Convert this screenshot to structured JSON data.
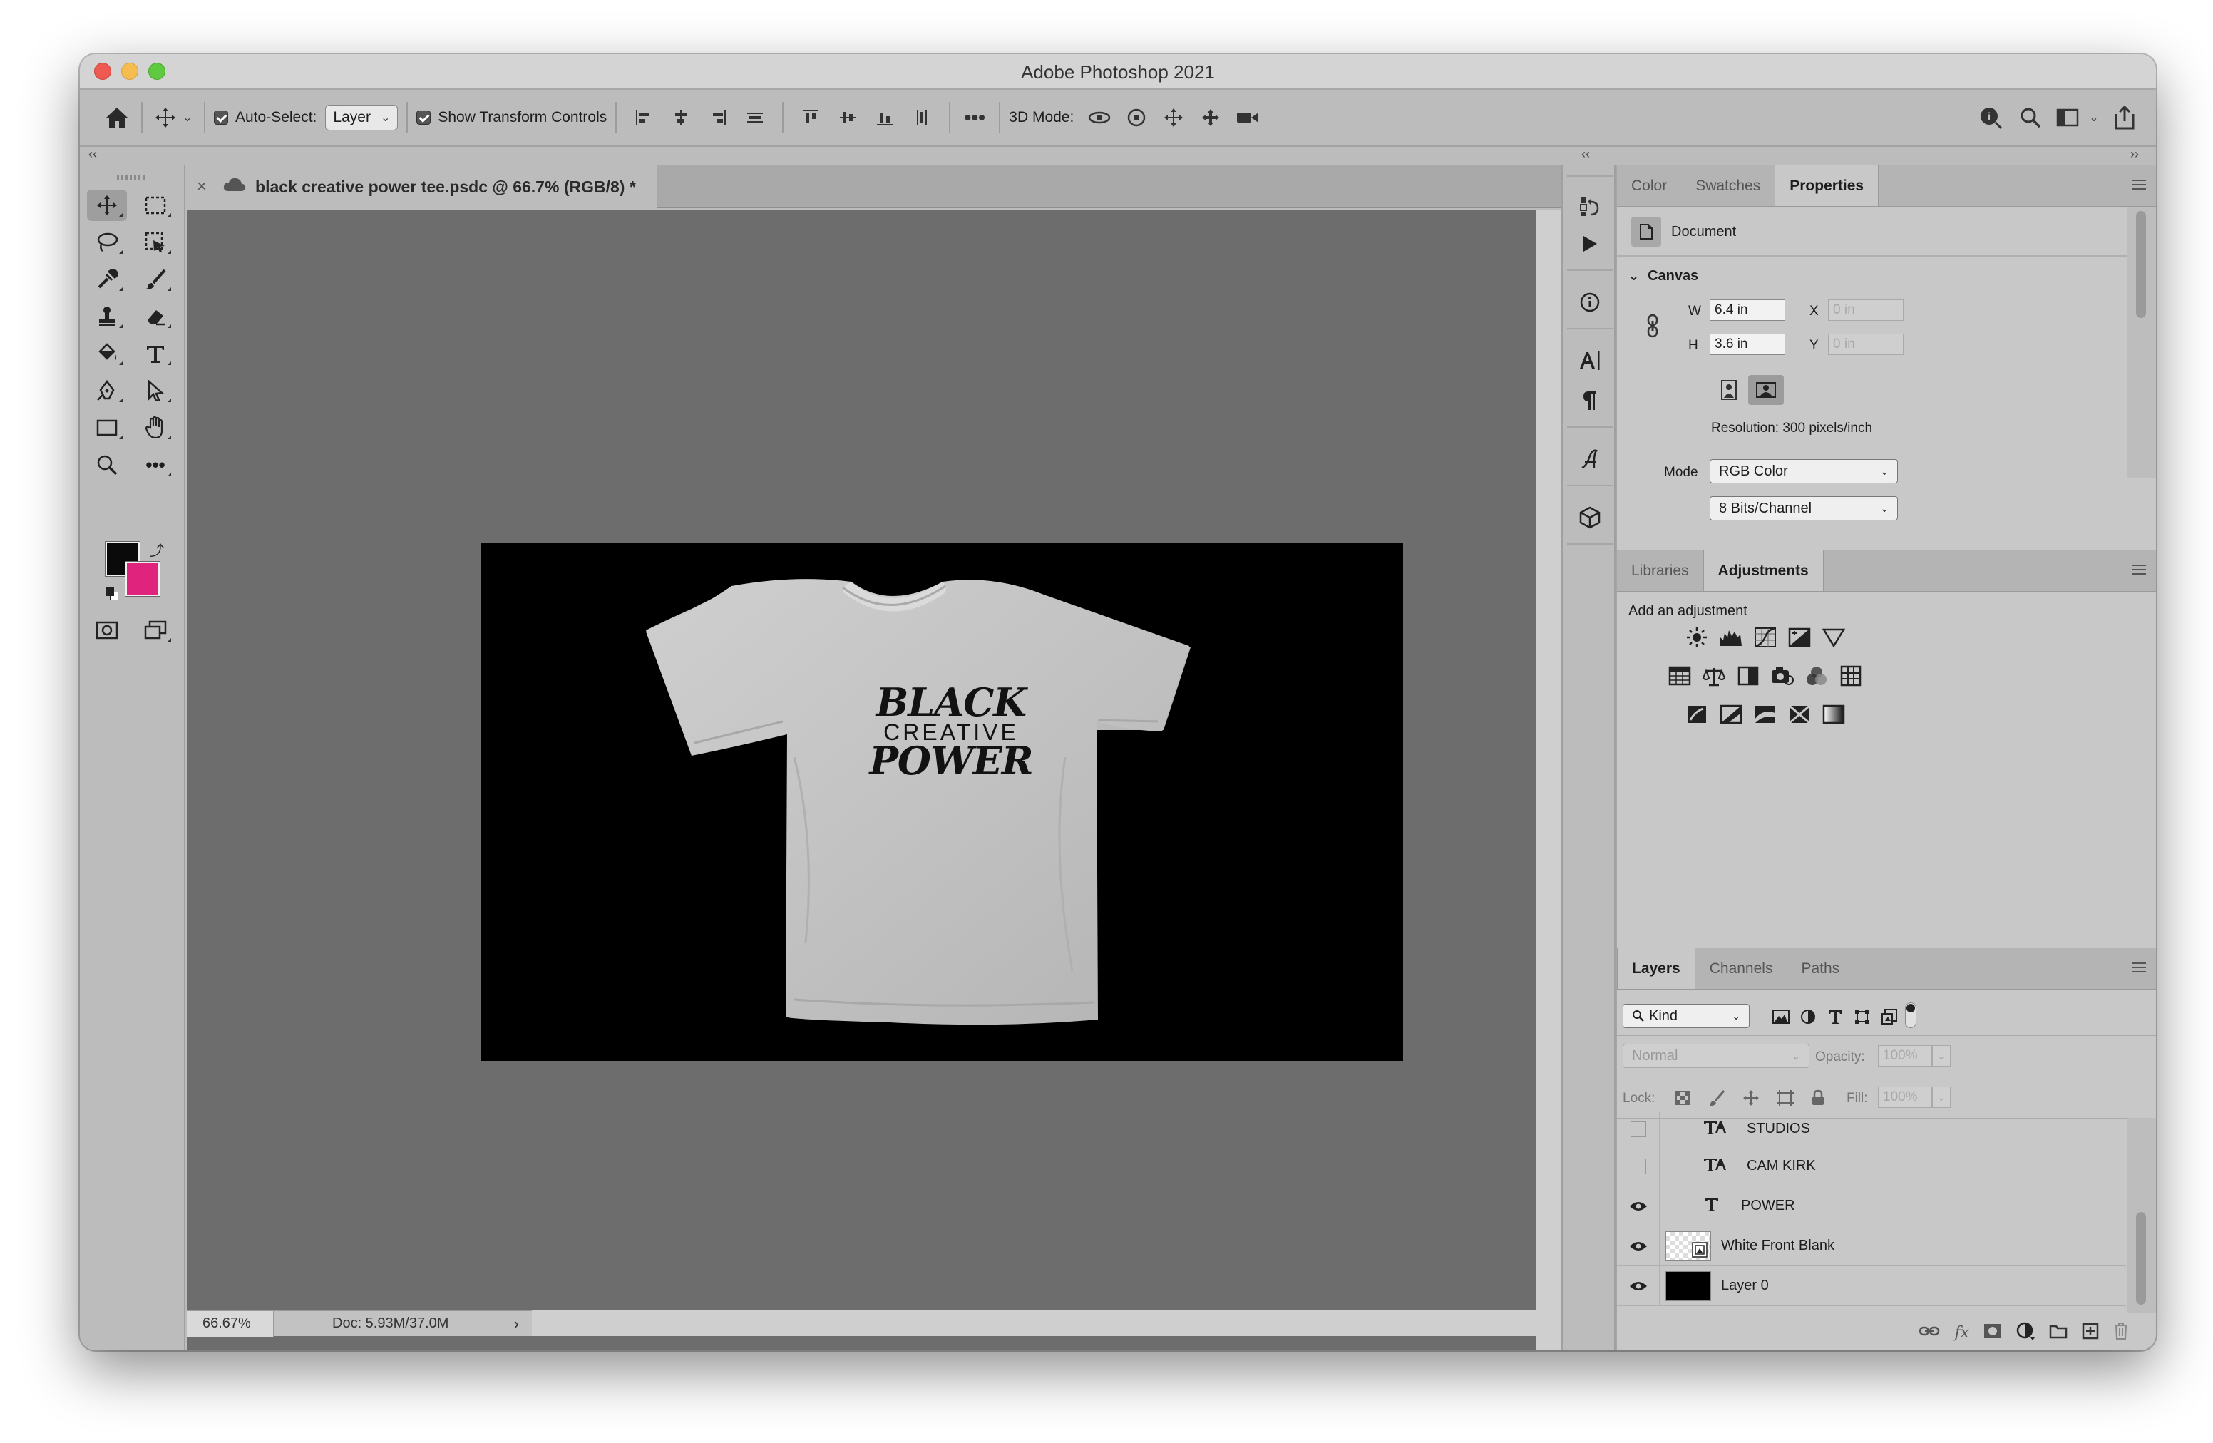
{
  "window": {
    "title": "Adobe Photoshop 2021"
  },
  "options_bar": {
    "auto_select_label": "Auto-Select:",
    "auto_select_value": "Layer",
    "show_transform_label": "Show Transform Controls",
    "three_d_mode_label": "3D Mode:"
  },
  "document": {
    "tab_title": "black creative power tee.psdc @ 66.7% (RGB/8) *",
    "close_glyph": "×"
  },
  "artwork": {
    "line1": "BLACK",
    "line2": "CREATIVE",
    "line3": "POWER"
  },
  "colors": {
    "foreground": "#0a0a0a",
    "background": "#e0247e",
    "canvas_bg": "#6d6d6d",
    "artboard": "#000000"
  },
  "status": {
    "zoom": "66.67%",
    "doc": "Doc: 5.93M/37.0M",
    "more": "›"
  },
  "properties_panel": {
    "tabs": [
      "Color",
      "Swatches",
      "Properties"
    ],
    "active_tab": "Properties",
    "doc_label": "Document",
    "canvas_section": "Canvas",
    "w_label": "W",
    "w_value": "6.4 in",
    "h_label": "H",
    "h_value": "3.6 in",
    "x_label": "X",
    "x_value": "0 in",
    "y_label": "Y",
    "y_value": "0 in",
    "resolution": "Resolution: 300 pixels/inch",
    "mode_label": "Mode",
    "mode_value": "RGB Color",
    "bits_value": "8 Bits/Channel"
  },
  "adjustments_panel": {
    "tabs": [
      "Libraries",
      "Adjustments"
    ],
    "active_tab": "Adjustments",
    "heading": "Add an adjustment"
  },
  "layers_panel": {
    "tabs": [
      "Layers",
      "Channels",
      "Paths"
    ],
    "active_tab": "Layers",
    "filter_kind": "Kind",
    "blend_mode": "Normal",
    "opacity_label": "Opacity:",
    "opacity_value": "100%",
    "lock_label": "Lock:",
    "fill_label": "Fill:",
    "fill_value": "100%",
    "layers": [
      {
        "name": "STUDIOS",
        "type": "warp-text",
        "visible": false
      },
      {
        "name": "CAM KIRK",
        "type": "warp-text",
        "visible": false
      },
      {
        "name": "POWER",
        "type": "text",
        "visible": true
      },
      {
        "name": "White Front Blank",
        "type": "smart-object",
        "visible": true
      },
      {
        "name": "Layer 0",
        "type": "pixel",
        "visible": true
      }
    ]
  }
}
